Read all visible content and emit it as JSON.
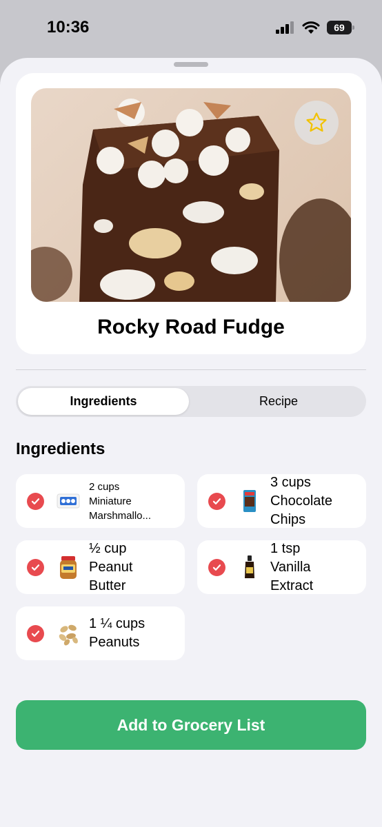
{
  "status_bar": {
    "time": "10:36",
    "battery": "69"
  },
  "recipe": {
    "title": "Rocky Road Fudge"
  },
  "tabs": [
    {
      "label": "Ingredients",
      "selected": true
    },
    {
      "label": "Recipe",
      "selected": false
    }
  ],
  "ingredients_section": {
    "title": "Ingredients",
    "items": [
      {
        "lines": [
          "2 cups",
          "Miniature",
          "Marshmallo..."
        ],
        "checked": true,
        "icon": "marshmallow-bag-icon"
      },
      {
        "lines": [
          "3 cups",
          "Chocolate",
          "Chips"
        ],
        "checked": true,
        "icon": "chocolate-chips-bag-icon"
      },
      {
        "lines": [
          "½ cup",
          "Peanut",
          "Butter"
        ],
        "checked": true,
        "icon": "peanut-butter-jar-icon"
      },
      {
        "lines": [
          "1 tsp",
          "Vanilla",
          "Extract"
        ],
        "checked": true,
        "icon": "vanilla-bottle-icon"
      },
      {
        "lines": [
          "1 ¼ cups",
          "Peanuts"
        ],
        "checked": true,
        "icon": "peanuts-icon"
      }
    ]
  },
  "actions": {
    "add_to_grocery_list": "Add to Grocery List"
  },
  "colors": {
    "check": "#e84a4f",
    "cta": "#3cb371",
    "star": "#f2c200"
  }
}
